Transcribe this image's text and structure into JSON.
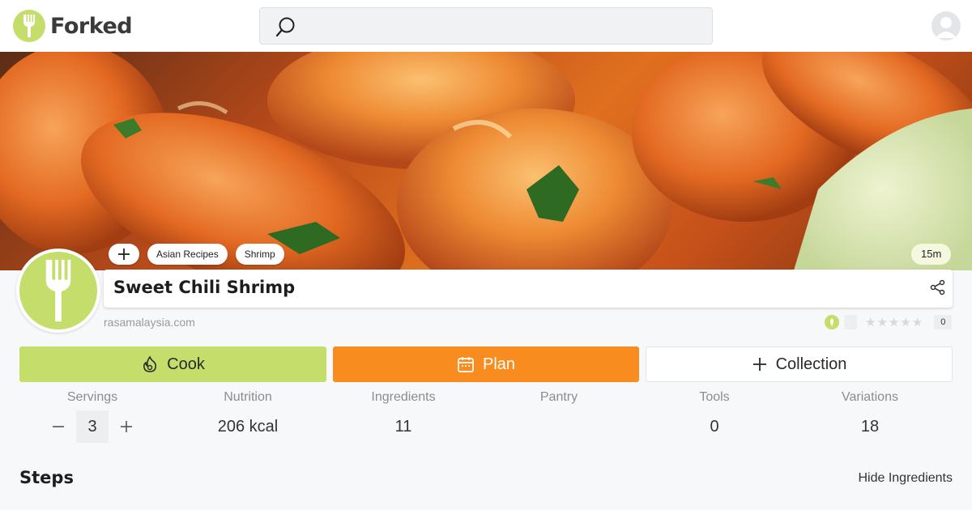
{
  "app": {
    "brand_name": "Forked",
    "accent_color": "#c5dd6b",
    "plan_color": "#f88c1e"
  },
  "search": {
    "placeholder": ""
  },
  "recipe": {
    "tags": [
      "Asian Recipes",
      "Shrimp"
    ],
    "time": "15m",
    "title": "Sweet Chili Shrimp",
    "source": "rasamalaysia.com",
    "rating": {
      "stars": 0,
      "max_stars": 5,
      "count": "0"
    }
  },
  "actions": {
    "cook_label": "Cook",
    "plan_label": "Plan",
    "collection_label": "Collection"
  },
  "stats": {
    "servings": {
      "label": "Servings",
      "value": "3"
    },
    "nutrition": {
      "label": "Nutrition",
      "value": "206 kcal"
    },
    "ingredients": {
      "label": "Ingredients",
      "value": "11"
    },
    "pantry": {
      "label": "Pantry",
      "value": ""
    },
    "tools": {
      "label": "Tools",
      "value": "0"
    },
    "variations": {
      "label": "Variations",
      "value": "18"
    }
  },
  "steps_section": {
    "heading": "Steps",
    "toggle_label": "Hide Ingredients"
  }
}
